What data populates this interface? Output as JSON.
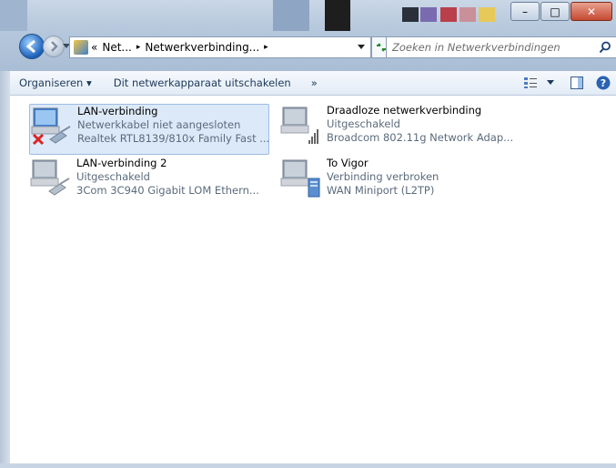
{
  "caption_buttons": {
    "minimize": "–",
    "maximize": "□",
    "close": "✕"
  },
  "address": {
    "prefix": "«",
    "crumbs": [
      "Net...",
      "Netwerkverbinding..."
    ],
    "separator": "▸"
  },
  "search": {
    "placeholder": "Zoeken in Netwerkverbindingen"
  },
  "toolbar": {
    "organize_label": "Organiseren ▾",
    "disable_label": "Dit netwerkapparaat uitschakelen",
    "more_label": "»"
  },
  "connections": [
    {
      "name": "LAN-verbinding",
      "status": "Netwerkkabel niet aangesloten",
      "device": "Realtek RTL8139/810x Family Fast ..."
    },
    {
      "name": "Draadloze netwerkverbinding",
      "status": "Uitgeschakeld",
      "device": "Broadcom 802.11g Network Adap..."
    },
    {
      "name": "LAN-verbinding 2",
      "status": "Uitgeschakeld",
      "device": "3Com 3C940 Gigabit LOM Ethern..."
    },
    {
      "name": "To Vigor",
      "status": "Verbinding verbroken",
      "device": "WAN Miniport (L2TP)"
    }
  ]
}
